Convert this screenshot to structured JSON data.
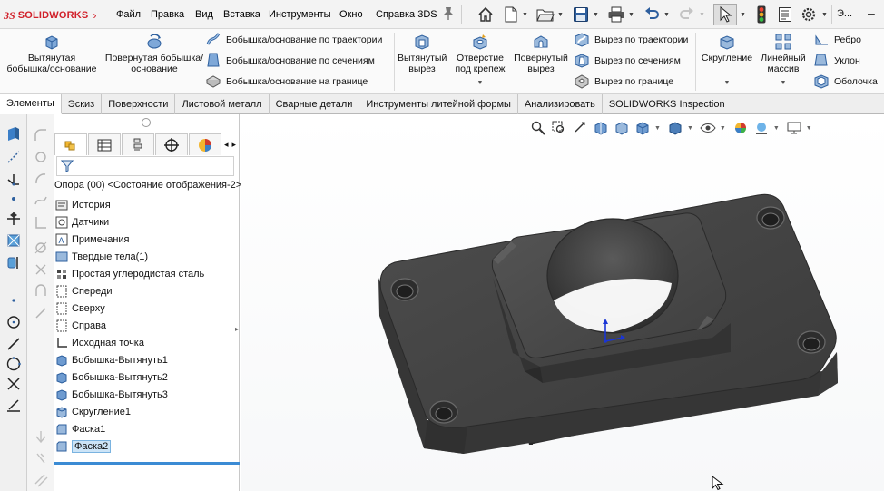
{
  "app": {
    "brand": "SOLIDWORKS",
    "brand_prefix": "3S"
  },
  "menu": [
    "Файл",
    "Правка",
    "Вид",
    "Вставка",
    "Инструменты",
    "Окно",
    "Справка 3DS"
  ],
  "ribbon": {
    "extrude_boss": "Вытянутая бобышка/основание",
    "revolve_boss": "Повернутая бобышка/основание",
    "sweep_boss": "Бобышка/основание по траектории",
    "loft_boss": "Бобышка/основание по сечениям",
    "boundary_boss": "Бобышка/основание на границе",
    "extruded_cut": "Вытянутый вырез",
    "hole_wizard": "Отверстие под крепеж",
    "revolved_cut": "Повернутый вырез",
    "swept_cut": "Вырез по траектории",
    "lofted_cut": "Вырез по сечениям",
    "boundary_cut": "Вырез по границе",
    "fillet": "Скругление",
    "linear_pattern": "Линейный массив",
    "rib": "Ребро",
    "draft": "Уклон",
    "shell": "Оболочка"
  },
  "tabs": [
    "Элементы",
    "Эскиз",
    "Поверхности",
    "Листовой металл",
    "Сварные детали",
    "Инструменты литейной формы",
    "Анализировать",
    "SOLIDWORKS Inspection"
  ],
  "feature_tree": {
    "root": "Опора (00) <Состояние отображения-2>",
    "items": [
      {
        "label": "История",
        "icon": "history-icon"
      },
      {
        "label": "Датчики",
        "icon": "sensor-icon"
      },
      {
        "label": "Примечания",
        "icon": "annotations-icon"
      },
      {
        "label": "Твердые тела(1)",
        "icon": "solid-bodies-icon"
      },
      {
        "label": "Простая углеродистая сталь",
        "icon": "material-icon"
      },
      {
        "label": "Спереди",
        "icon": "plane-icon"
      },
      {
        "label": "Сверху",
        "icon": "plane-icon"
      },
      {
        "label": "Справа",
        "icon": "plane-icon"
      },
      {
        "label": "Исходная точка",
        "icon": "origin-icon"
      },
      {
        "label": "Бобышка-Вытянуть1",
        "icon": "extrude-icon"
      },
      {
        "label": "Бобышка-Вытянуть2",
        "icon": "extrude-icon"
      },
      {
        "label": "Бобышка-Вытянуть3",
        "icon": "extrude-icon"
      },
      {
        "label": "Скругление1",
        "icon": "fillet-icon"
      },
      {
        "label": "Фаска1",
        "icon": "chamfer-icon"
      },
      {
        "label": "Фаска2",
        "icon": "chamfer-icon",
        "selected": true
      }
    ]
  },
  "colors": {
    "accent": "#3b8bd4",
    "brand": "#d1202a",
    "part": "#4a4a4a",
    "selection": "#cce4f7"
  }
}
